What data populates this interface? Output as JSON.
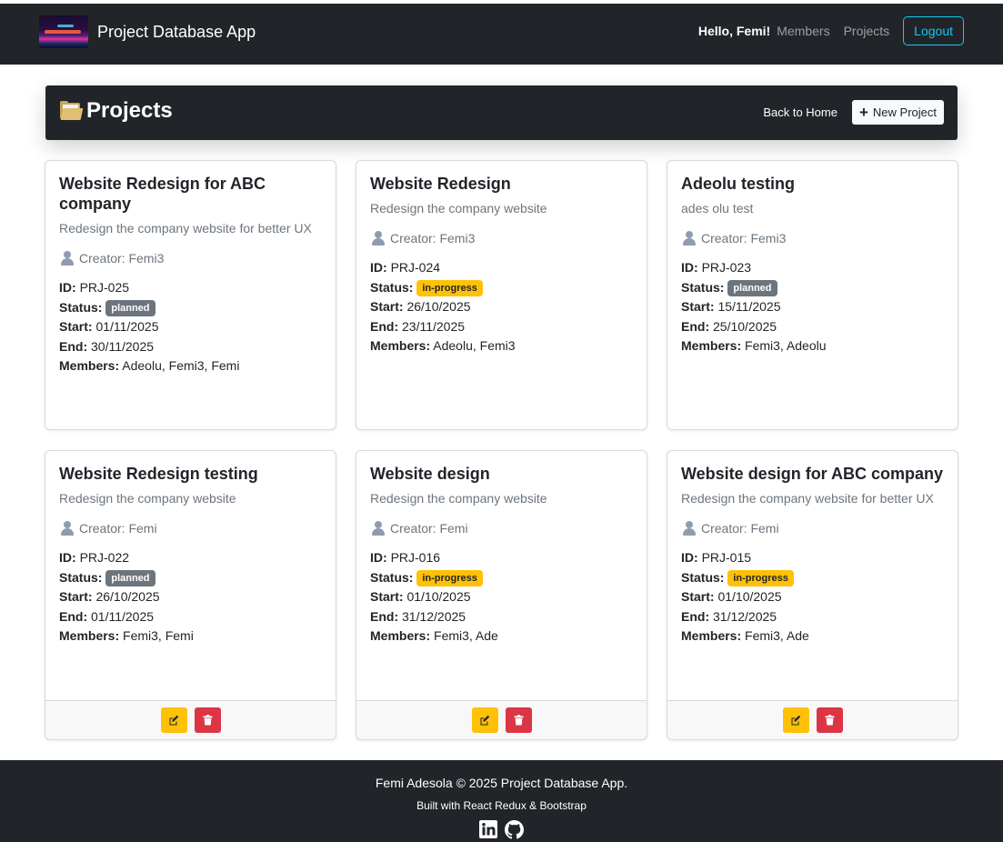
{
  "navbar": {
    "brand": "Project Database App",
    "greeting": "Hello, Femi!",
    "links": [
      "Members",
      "Projects"
    ],
    "logout_label": "Logout"
  },
  "page_header": {
    "title": "Projects",
    "back_label": "Back to Home",
    "new_label": "New Project"
  },
  "labels": {
    "creator_prefix": "Creator: ",
    "id": "ID:",
    "status": "Status:",
    "start": "Start:",
    "end": "End:",
    "members": "Members:"
  },
  "projects": [
    {
      "title": "Website Redesign for ABC company",
      "description": "Redesign the company website for better UX",
      "creator": "Femi3",
      "id": "PRJ-025",
      "status": "planned",
      "start": "01/11/2025",
      "end": "30/11/2025",
      "members": "Adeolu, Femi3, Femi"
    },
    {
      "title": "Website Redesign",
      "description": "Redesign the company website",
      "creator": "Femi3",
      "id": "PRJ-024",
      "status": "in-progress",
      "start": "26/10/2025",
      "end": "23/11/2025",
      "members": "Adeolu, Femi3"
    },
    {
      "title": "Adeolu testing",
      "description": "ades olu test",
      "creator": "Femi3",
      "id": "PRJ-023",
      "status": "planned",
      "start": "15/11/2025",
      "end": "25/10/2025",
      "members": "Femi3, Adeolu"
    },
    {
      "title": "Website Redesign testing",
      "description": "Redesign the company website",
      "creator": "Femi",
      "id": "PRJ-022",
      "status": "planned",
      "start": "26/10/2025",
      "end": "01/11/2025",
      "members": "Femi3, Femi"
    },
    {
      "title": "Website design",
      "description": "Redesign the company website",
      "creator": "Femi",
      "id": "PRJ-016",
      "status": "in-progress",
      "start": "01/10/2025",
      "end": "31/12/2025",
      "members": "Femi3, Ade"
    },
    {
      "title": "Website design for ABC company",
      "description": "Redesign the company website for better UX",
      "creator": "Femi",
      "id": "PRJ-015",
      "status": "in-progress",
      "start": "01/10/2025",
      "end": "31/12/2025",
      "members": "Femi3, Ade"
    }
  ],
  "footer": {
    "copyright": "Femi Adesola © 2025 Project Database App.",
    "built_with": "Built with React Redux & Bootstrap",
    "icons": [
      "linkedin-icon",
      "github-icon"
    ]
  },
  "colors": {
    "dark": "#212529",
    "accent": "#0dcaf0",
    "warning": "#ffc107",
    "danger": "#dc3545",
    "secondary": "#6c757d"
  }
}
